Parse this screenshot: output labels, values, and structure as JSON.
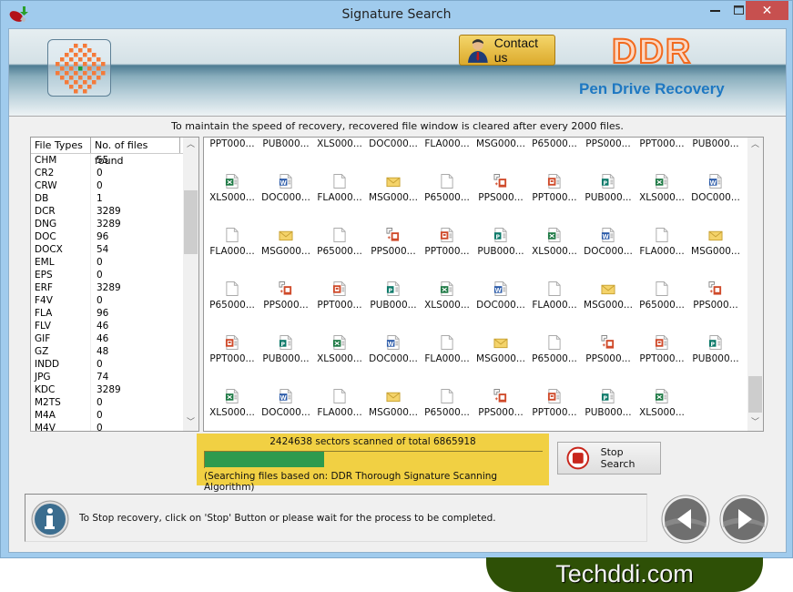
{
  "window": {
    "title": "Signature Search",
    "controls": {
      "minimize": "—",
      "maximize": "☐",
      "close": "✕"
    }
  },
  "banner": {
    "contact_label": "Contact us",
    "brand": "DDR",
    "product": "Pen Drive Recovery"
  },
  "notice": "To maintain the speed of recovery, recovered file window is cleared after every 2000 files.",
  "file_types": {
    "headers": [
      "File Types",
      "No. of files found"
    ],
    "rows": [
      [
        "CHM",
        "55"
      ],
      [
        "CR2",
        "0"
      ],
      [
        "CRW",
        "0"
      ],
      [
        "DB",
        "1"
      ],
      [
        "DCR",
        "3289"
      ],
      [
        "DNG",
        "3289"
      ],
      [
        "DOC",
        "96"
      ],
      [
        "DOCX",
        "54"
      ],
      [
        "EML",
        "0"
      ],
      [
        "EPS",
        "0"
      ],
      [
        "ERF",
        "3289"
      ],
      [
        "F4V",
        "0"
      ],
      [
        "FLA",
        "96"
      ],
      [
        "FLV",
        "46"
      ],
      [
        "GIF",
        "46"
      ],
      [
        "GZ",
        "48"
      ],
      [
        "INDD",
        "0"
      ],
      [
        "JPG",
        "74"
      ],
      [
        "KDC",
        "3289"
      ],
      [
        "M2TS",
        "0"
      ],
      [
        "M4A",
        "0"
      ],
      [
        "M4V",
        "0"
      ]
    ]
  },
  "file_grid": {
    "rows": [
      [
        "PPT",
        "PUB",
        "XLS",
        "DOC",
        "FLA",
        "MSG",
        "P65",
        "PPS",
        "PPT",
        "PUB"
      ],
      [
        "XLS",
        "DOC",
        "FLA",
        "MSG",
        "P65",
        "PPS",
        "PPT",
        "PUB",
        "XLS",
        "DOC"
      ],
      [
        "FLA",
        "MSG",
        "P65",
        "PPS",
        "PPT",
        "PUB",
        "XLS",
        "DOC",
        "FLA",
        "MSG"
      ],
      [
        "P65",
        "PPS",
        "PPT",
        "PUB",
        "XLS",
        "DOC",
        "FLA",
        "MSG",
        "P65",
        "PPS"
      ],
      [
        "PPT",
        "PUB",
        "XLS",
        "DOC",
        "FLA",
        "MSG",
        "P65",
        "PPS",
        "PPT",
        "PUB"
      ],
      [
        "XLS",
        "DOC",
        "FLA",
        "MSG",
        "P65",
        "PPS",
        "PPT",
        "PUB",
        "XLS"
      ]
    ],
    "label_suffix": "000..."
  },
  "progress": {
    "sectors_text": "2424638 sectors scanned of total 6865918",
    "scanned": 2424638,
    "total": 6865918,
    "fraction": 0.353,
    "algorithm_text": "(Searching files based on:  DDR Thorough Signature Scanning Algorithm)"
  },
  "stop_button": {
    "label": "Stop Search"
  },
  "status": {
    "message": "To Stop recovery, click on 'Stop' Button or please wait for the process to be completed."
  },
  "watermark": "Techddi.com",
  "colors": {
    "progress_fill": "#2e9a4e",
    "panel": "#f1d043",
    "brand_orange": "#f26a1e",
    "product_blue": "#1e78c2",
    "close_red": "#c7504f"
  }
}
